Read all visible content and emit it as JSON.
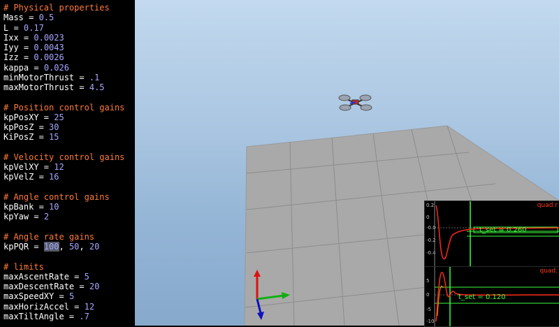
{
  "config": {
    "lines": [
      {
        "type": "comment",
        "text": "# Physical properties"
      },
      {
        "type": "kv",
        "key": "Mass",
        "value": "0.5"
      },
      {
        "type": "kv",
        "key": "L",
        "value": "0.17"
      },
      {
        "type": "kv",
        "key": "Ixx",
        "value": "0.0023"
      },
      {
        "type": "kv",
        "key": "Iyy",
        "value": "0.0043"
      },
      {
        "type": "kv",
        "key": "Izz",
        "value": "0.0026"
      },
      {
        "type": "kv",
        "key": "kappa",
        "value": "0.026"
      },
      {
        "type": "kv",
        "key": "minMotorThrust",
        "value": ".1"
      },
      {
        "type": "kv",
        "key": "maxMotorThrust",
        "value": "4.5"
      },
      {
        "type": "blank"
      },
      {
        "type": "comment",
        "text": "# Position control gains"
      },
      {
        "type": "kv",
        "key": "kpPosXY",
        "value": "25"
      },
      {
        "type": "kv",
        "key": "kpPosZ",
        "value": "30"
      },
      {
        "type": "kv",
        "key": "KiPosZ",
        "value": "15"
      },
      {
        "type": "blank"
      },
      {
        "type": "comment",
        "text": "# Velocity control gains"
      },
      {
        "type": "kv",
        "key": "kpVelXY",
        "value": "12"
      },
      {
        "type": "kv",
        "key": "kpVelZ",
        "value": "16"
      },
      {
        "type": "blank"
      },
      {
        "type": "comment",
        "text": "# Angle control gains"
      },
      {
        "type": "kv",
        "key": "kpBank",
        "value": "10"
      },
      {
        "type": "kv",
        "key": "kpYaw",
        "value": "2"
      },
      {
        "type": "blank"
      },
      {
        "type": "comment",
        "text": "# Angle rate gains"
      },
      {
        "type": "kv3",
        "key": "kpPQR",
        "values": [
          "100",
          "50",
          "20"
        ]
      },
      {
        "type": "blank"
      },
      {
        "type": "comment",
        "text": "# limits"
      },
      {
        "type": "kv",
        "key": "maxAscentRate",
        "value": "5"
      },
      {
        "type": "kv",
        "key": "maxDescentRate",
        "value": "20"
      },
      {
        "type": "kv",
        "key": "maxSpeedXY",
        "value": "5"
      },
      {
        "type": "kv",
        "key": "maxHorizAccel",
        "value": "12"
      },
      {
        "type": "kv",
        "key": "maxTiltAngle",
        "value": ".7"
      }
    ]
  },
  "plots": {
    "top": {
      "title": "quad.r",
      "ticks": [
        "0.2",
        "0",
        "-0.0",
        "-0.2",
        "-0.4"
      ],
      "label": "t_set = 0.260"
    },
    "bottom": {
      "title": "quad.",
      "ticks": [
        "5",
        "0",
        "-5",
        "-10"
      ],
      "label": "t_set = 0.120"
    }
  },
  "colors": {
    "comment": "#ff7a3a",
    "value": "#a7a7ff",
    "sky_top": "#c2d9ee",
    "sky_bottom": "#86a9cc",
    "floor": "#a9a9a9",
    "plot_curve": "#ff2a1a",
    "plot_marker": "#3cff3c"
  }
}
